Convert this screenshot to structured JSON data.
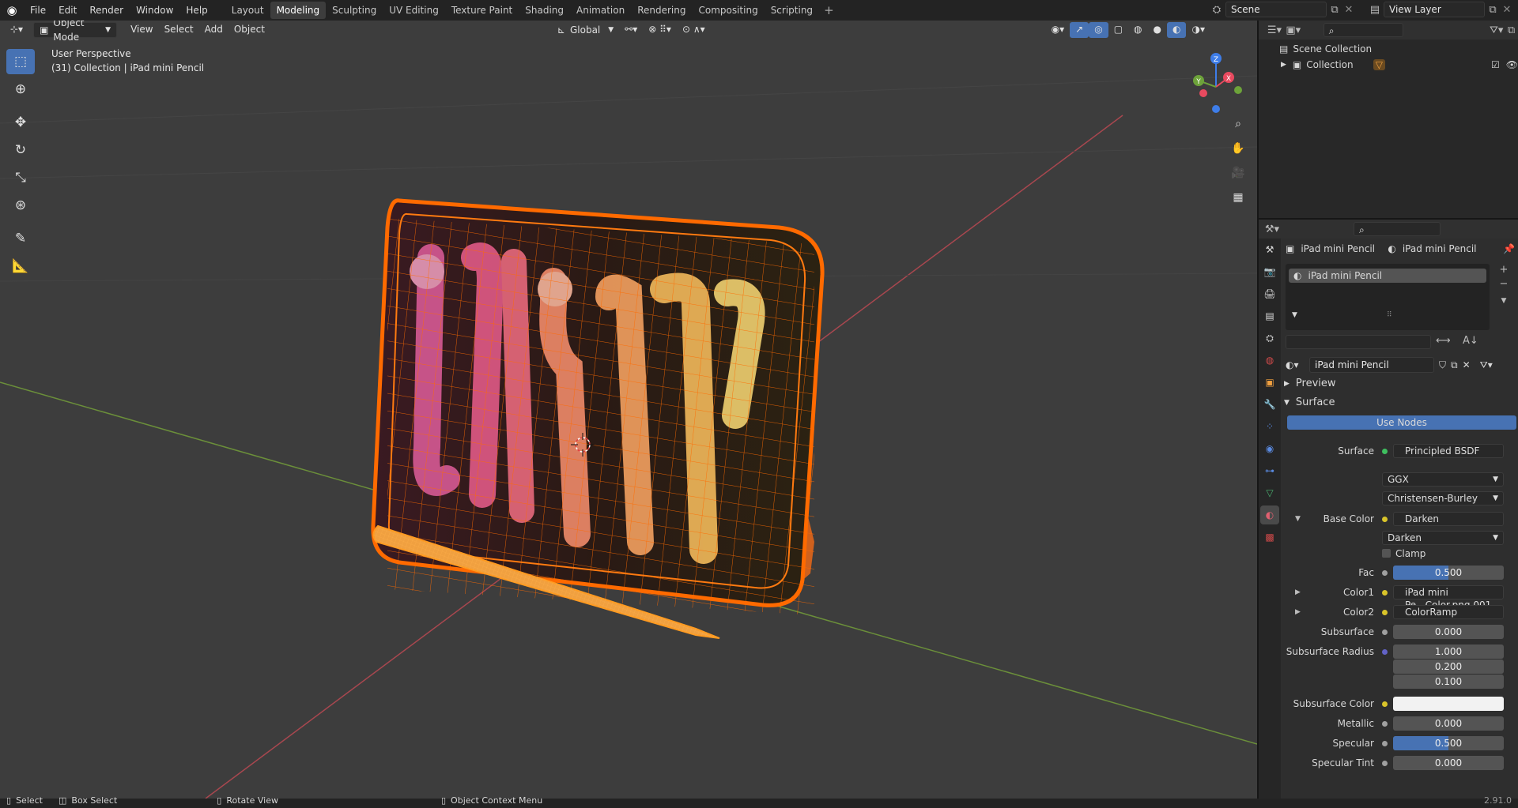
{
  "menu": [
    "File",
    "Edit",
    "Render",
    "Window",
    "Help"
  ],
  "workspaces": [
    "Layout",
    "Modeling",
    "Sculpting",
    "UV Editing",
    "Texture Paint",
    "Shading",
    "Animation",
    "Rendering",
    "Compositing",
    "Scripting"
  ],
  "workspace_add": "+",
  "scene_name": "Scene",
  "view_layer": "View Layer",
  "viewport": {
    "mode": "Object Mode",
    "menus": [
      "View",
      "Select",
      "Add",
      "Object"
    ],
    "transform_orientation": "Global",
    "view_name": "User Perspective",
    "collection_info": "(31) Collection | iPad mini Pencil",
    "gizmo": {
      "x": "X",
      "y": "Y",
      "z": "Z"
    }
  },
  "outliner": {
    "scene_collection": "Scene Collection",
    "collection": "Collection"
  },
  "properties": {
    "object_name": "iPad mini Pencil",
    "material_name": "iPad mini Pencil",
    "slot_item": "iPad mini Pencil",
    "material_field": "iPad mini Pencil",
    "panels": {
      "preview": "Preview",
      "surface": "Surface"
    },
    "use_nodes": "Use Nodes",
    "rows": [
      {
        "label": "Surface",
        "value": "Principled BSDF"
      },
      {
        "label": "",
        "value": "GGX"
      },
      {
        "label": "",
        "value": "Christensen-Burley"
      },
      {
        "label": "Base Color",
        "value": "Darken"
      },
      {
        "label": "",
        "value": "Darken"
      },
      {
        "label": "",
        "value": "Clamp"
      },
      {
        "label": "Fac",
        "value": "0.500"
      },
      {
        "label": "Color1",
        "value": "iPad mini Pe...Color.png.001"
      },
      {
        "label": "Color2",
        "value": "ColorRamp"
      },
      {
        "label": "Subsurface",
        "value": "0.000"
      },
      {
        "label": "Subsurface Radius",
        "value": "1.000"
      },
      {
        "label": "",
        "value": "0.200"
      },
      {
        "label": "",
        "value": "0.100"
      },
      {
        "label": "Subsurface Color",
        "value": ""
      },
      {
        "label": "Metallic",
        "value": "0.000"
      },
      {
        "label": "Specular",
        "value": "0.500"
      },
      {
        "label": "Specular Tint",
        "value": "0.000"
      }
    ],
    "fac_fill": 0.5,
    "specular_fill": 0.5
  },
  "status": {
    "select": "Select",
    "box_select": "Box Select",
    "rotate_view": "Rotate View",
    "context_menu": "Object Context Menu",
    "version": "2.91.0"
  },
  "colors": {
    "accent": "#4772b3",
    "selection": "#ff6a00",
    "x_axis": "#e84a5f",
    "y_axis": "#6da33a",
    "z_axis": "#3e7de8"
  }
}
